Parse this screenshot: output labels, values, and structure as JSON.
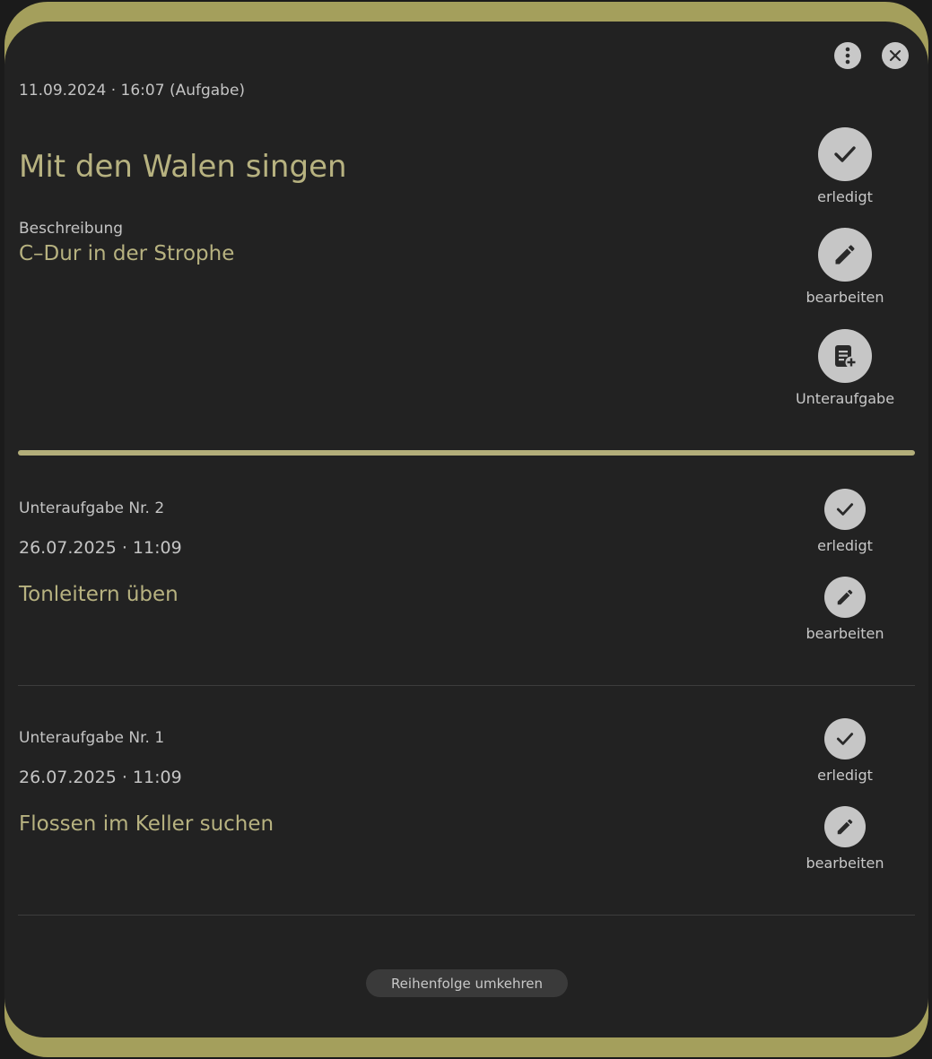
{
  "task": {
    "meta": "11.09.2024 · 16:07 (Aufgabe)",
    "title": "Mit den Walen singen",
    "description_label": "Beschreibung",
    "description": "C–Dur in der Strophe",
    "actions": {
      "done": "erledigt",
      "edit": "bearbeiten",
      "subtask": "Unteraufgabe"
    }
  },
  "subtasks": [
    {
      "number": "Unteraufgabe Nr. 2",
      "date": "26.07.2025 · 11:09",
      "title": "Tonleitern üben",
      "done": "erledigt",
      "edit": "bearbeiten"
    },
    {
      "number": "Unteraufgabe Nr. 1",
      "date": "26.07.2025 · 11:09",
      "title": "Flossen im Keller suchen",
      "done": "erledigt",
      "edit": "bearbeiten"
    }
  ],
  "footer": {
    "reverse_label": "Reihenfolge umkehren"
  },
  "colors": {
    "accent": "#b7b280",
    "frame": "#a49f5c",
    "panel": "#222222",
    "button": "#c6c6c6"
  },
  "icons": [
    "more-vertical-icon",
    "close-icon",
    "check-icon",
    "pencil-icon",
    "note-add-icon"
  ]
}
